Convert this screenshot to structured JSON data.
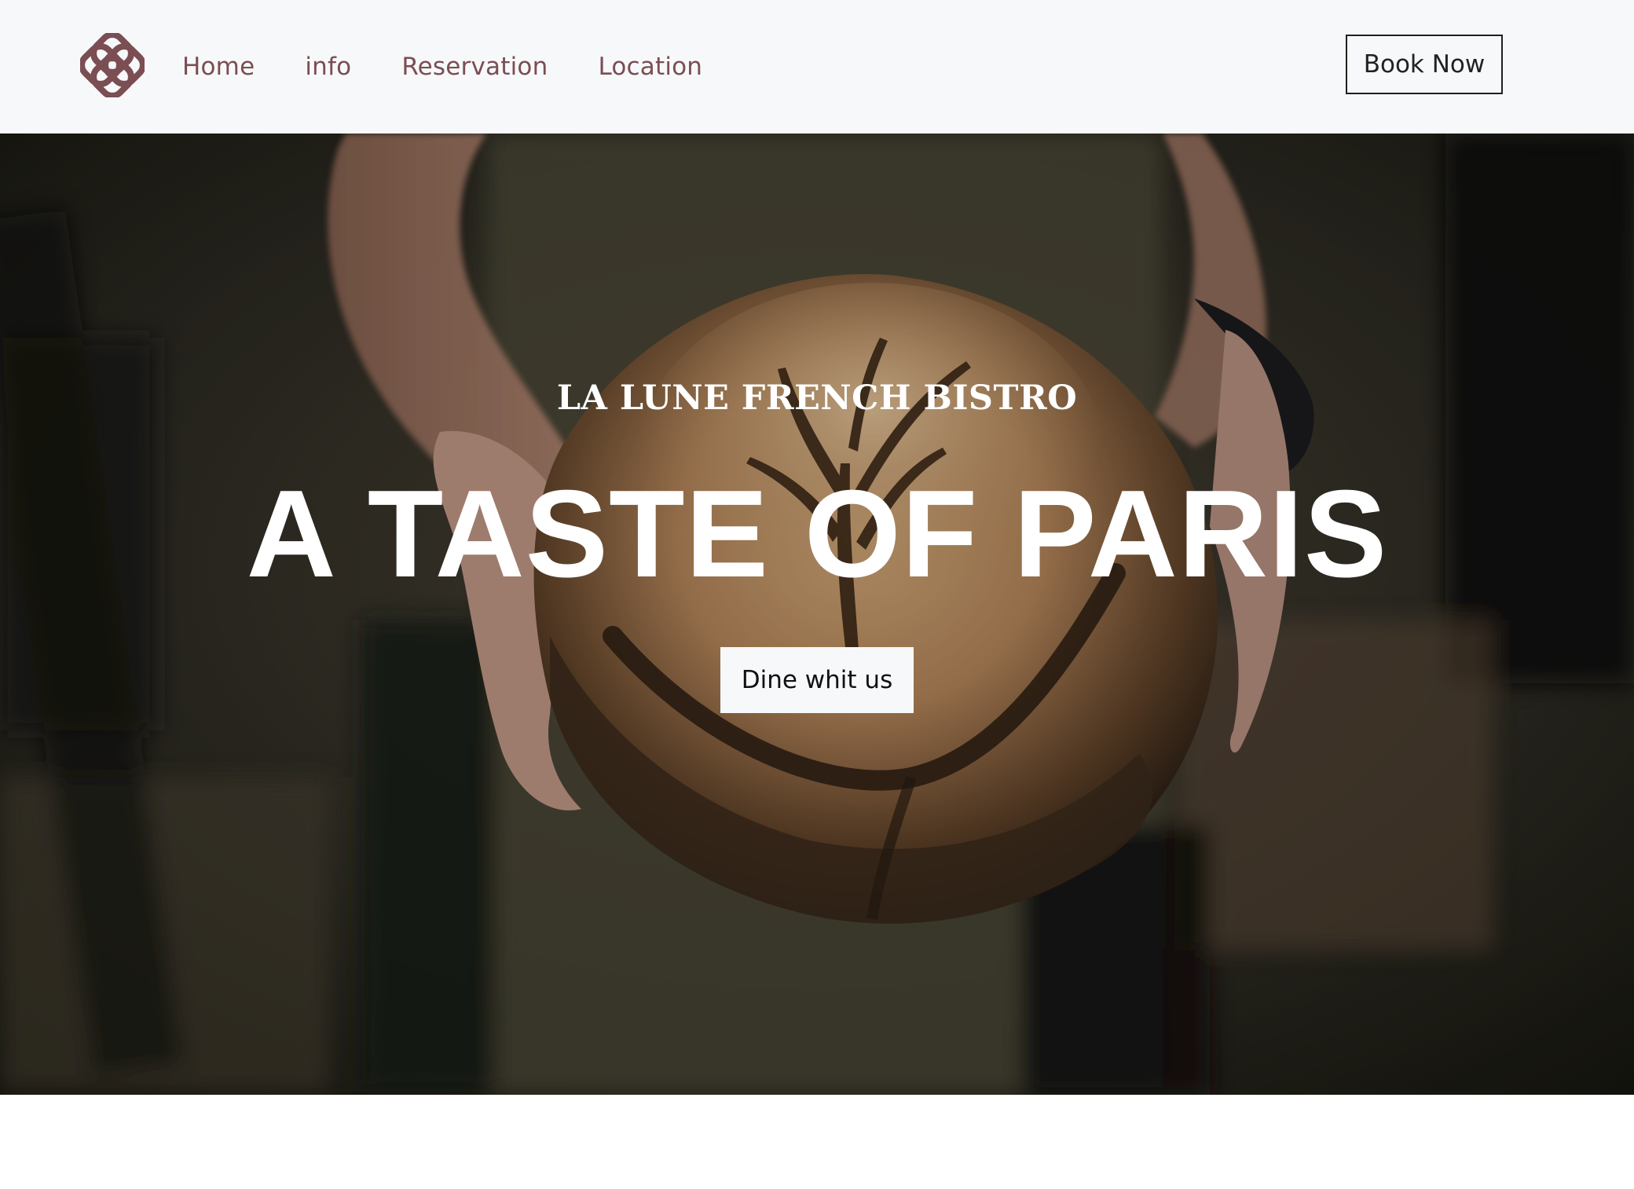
{
  "nav": {
    "logo_icon": "quatrefoil-logo-icon",
    "links": [
      "Home",
      "info",
      "Reservation",
      "Location"
    ],
    "book_label": "Book Now"
  },
  "hero": {
    "subtitle": "LA LUNE FRENCH BISTRO",
    "title": "A TASTE OF PARIS",
    "cta_label": "Dine whit us",
    "image": "bread-loaf-held-in-hands"
  },
  "colors": {
    "nav_bg": "#f7f8fa",
    "nav_link": "#7a4e52",
    "logo": "#7a4e52",
    "hero_text": "#ffffff"
  }
}
